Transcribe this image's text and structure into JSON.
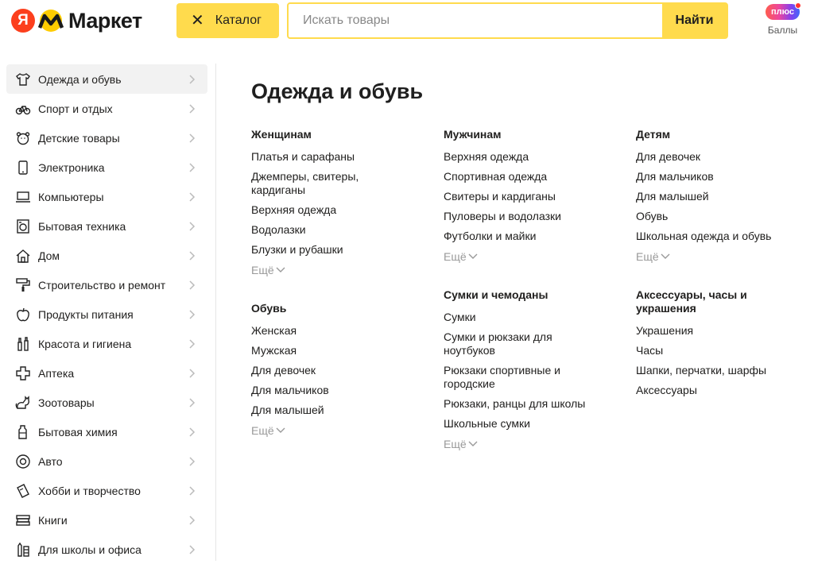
{
  "header": {
    "logo_letter": "Я",
    "logo_word": "Маркет",
    "catalog_icon": "close-icon",
    "catalog_label": "Каталог",
    "search_placeholder": "Искать товары",
    "search_button": "Найти",
    "plus_badge": "плюс",
    "plus_points": "Баллы"
  },
  "sidebar": {
    "items": [
      {
        "label": "Одежда и обувь",
        "icon": "tshirt-icon"
      },
      {
        "label": "Спорт и отдых",
        "icon": "bicycle-icon"
      },
      {
        "label": "Детские товары",
        "icon": "bear-icon"
      },
      {
        "label": "Электроника",
        "icon": "smartphone-icon"
      },
      {
        "label": "Компьютеры",
        "icon": "laptop-icon"
      },
      {
        "label": "Бытовая техника",
        "icon": "washing-machine-icon"
      },
      {
        "label": "Дом",
        "icon": "house-icon"
      },
      {
        "label": "Строительство и ремонт",
        "icon": "paint-roller-icon"
      },
      {
        "label": "Продукты питания",
        "icon": "apple-icon"
      },
      {
        "label": "Красота и гигиена",
        "icon": "cosmetics-icon"
      },
      {
        "label": "Аптека",
        "icon": "cross-icon"
      },
      {
        "label": "Зоотовары",
        "icon": "cat-icon"
      },
      {
        "label": "Бытовая химия",
        "icon": "detergent-icon"
      },
      {
        "label": "Авто",
        "icon": "tire-icon"
      },
      {
        "label": "Хобби и творчество",
        "icon": "tickets-icon"
      },
      {
        "label": "Книги",
        "icon": "books-icon"
      },
      {
        "label": "Для школы и офиса",
        "icon": "pencils-icon"
      }
    ]
  },
  "main": {
    "title": "Одежда и обувь",
    "more_label": "Ещё",
    "groups": {
      "women": {
        "title": "Женщинам",
        "links": [
          "Платья и сарафаны",
          "Джемперы, свитеры, кардиганы",
          "Верхняя одежда",
          "Водолазки",
          "Блузки и рубашки"
        ]
      },
      "shoes": {
        "title": "Обувь",
        "links": [
          "Женская",
          "Мужская",
          "Для девочек",
          "Для мальчиков",
          "Для малышей"
        ]
      },
      "men": {
        "title": "Мужчинам",
        "links": [
          "Верхняя одежда",
          "Спортивная одежда",
          "Свитеры и кардиганы",
          "Пуловеры и водолазки",
          "Футболки и майки"
        ]
      },
      "bags": {
        "title": "Сумки и чемоданы",
        "links": [
          "Сумки",
          "Сумки и рюкзаки для ноутбуков",
          "Рюкзаки спортивные и городские",
          "Рюкзаки, ранцы для школы",
          "Школьные сумки"
        ]
      },
      "kids": {
        "title": "Детям",
        "links": [
          "Для девочек",
          "Для мальчиков",
          "Для малышей",
          "Обувь",
          "Школьная одежда и обувь"
        ]
      },
      "accessories": {
        "title": "Аксессуары, часы и украшения",
        "links": [
          "Украшения",
          "Часы",
          "Шапки, перчатки, шарфы",
          "Аксессуары"
        ]
      }
    }
  },
  "colors": {
    "accent": "#ffdb4d",
    "logo_red": "#fc3f1d",
    "muted": "#999999"
  }
}
